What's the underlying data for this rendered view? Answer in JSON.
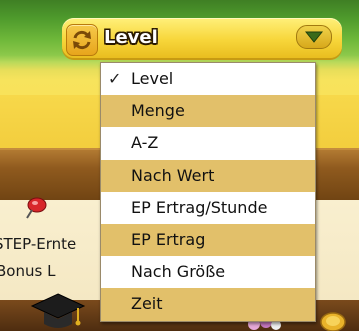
{
  "sort_control": {
    "current_label": "Level",
    "swap_icon": "swap-arrows-icon",
    "open_icon": "chevron-down-icon"
  },
  "dropdown": {
    "options": [
      {
        "label": "Level",
        "selected": true
      },
      {
        "label": "Menge",
        "selected": false
      },
      {
        "label": "A-Z",
        "selected": false
      },
      {
        "label": "Nach Wert",
        "selected": false
      },
      {
        "label": "EP Ertrag/Stunde",
        "selected": false
      },
      {
        "label": "EP Ertrag",
        "selected": false
      },
      {
        "label": "Nach Größe",
        "selected": false
      },
      {
        "label": "Zeit",
        "selected": false
      }
    ],
    "check_mark": "✓"
  },
  "background": {
    "card_line1": "STEP-Ernte",
    "card_line2": "Bonus L"
  },
  "colors": {
    "accent_yellow": "#f7d63a",
    "row_alt": "#e2c06a"
  }
}
